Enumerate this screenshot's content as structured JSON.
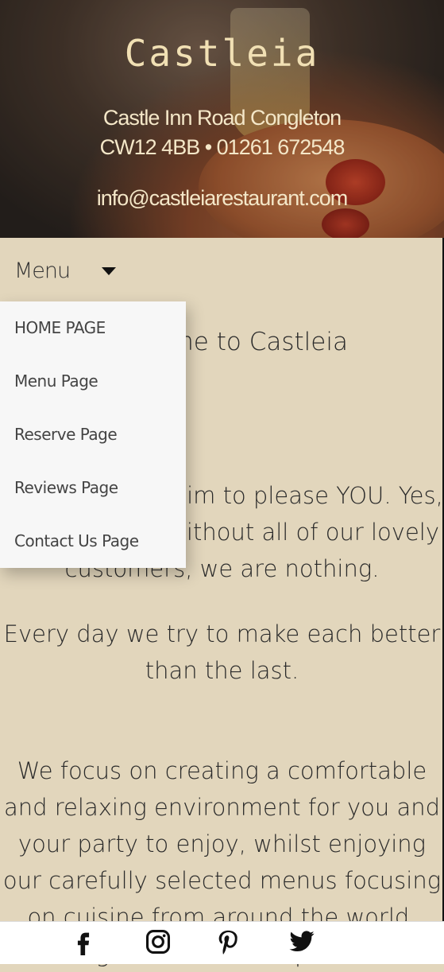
{
  "header": {
    "title": "Castleia",
    "address_line1": "Castle Inn Road Congleton",
    "address_line2": "CW12 4BB • 01261 672548",
    "email": "info@castleiarestaurant.com"
  },
  "nav": {
    "menu_label": "Menu",
    "items": [
      {
        "label": "HOME PAGE"
      },
      {
        "label": "Menu Page"
      },
      {
        "label": "Reserve Page"
      },
      {
        "label": "Reviews Page"
      },
      {
        "label": "Contact Us Page"
      }
    ]
  },
  "main": {
    "welcome": "Welcome to Castleia",
    "p1": "At Castleia we aim to please YOU. Yes, you! Because without all of our lovely customers, we are nothing.",
    "p2": "Every day we try to make each better than the last.",
    "p3": "We focus on creating a comfortable and relaxing environment for you and your party to enjoy, whilst enjoying our carefully selected menus focusing on cuisine from around the world, using the finest local produce."
  },
  "footer": {
    "icons": [
      "facebook-icon",
      "instagram-icon",
      "pinterest-icon",
      "twitter-icon"
    ],
    "peek_text": "produc"
  }
}
